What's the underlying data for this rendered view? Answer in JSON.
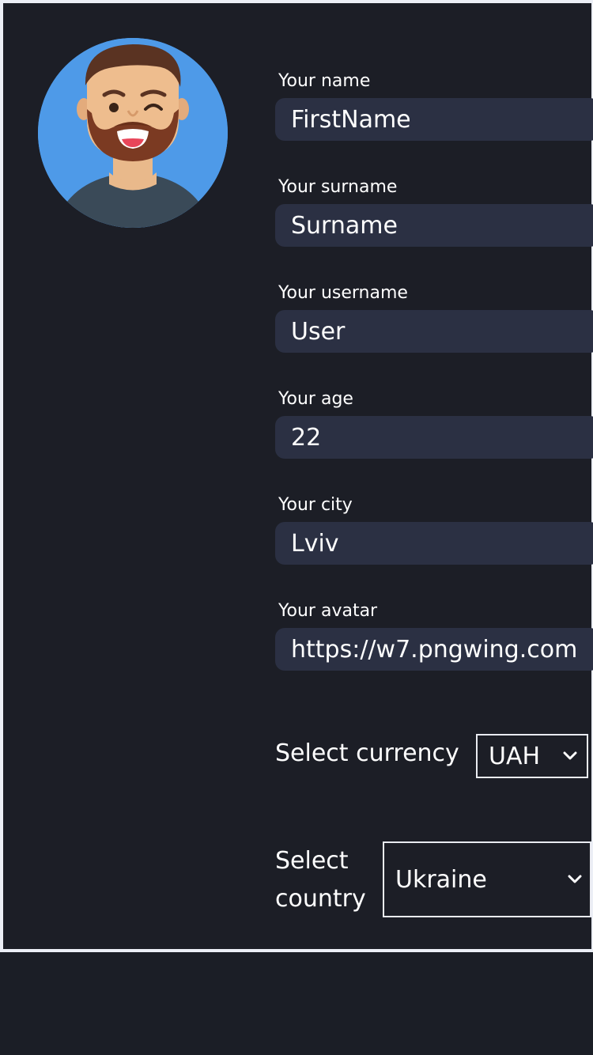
{
  "profile": {
    "avatar_icon": "avatar-image",
    "fields": [
      {
        "label": "Your name",
        "value": "FirstName"
      },
      {
        "label": "Your surname",
        "value": "Surname"
      },
      {
        "label": "Your username",
        "value": "User"
      },
      {
        "label": "Your age",
        "value": "22"
      },
      {
        "label": "Your city",
        "value": "Lviv"
      },
      {
        "label": "Your avatar",
        "value": "https://w7.pngwing.com"
      }
    ]
  },
  "currency": {
    "label": "Select currency",
    "selected": "UAH"
  },
  "country": {
    "label_line1": "Select",
    "label_line2": "country",
    "selected": "Ukraine"
  },
  "colors": {
    "background": "#1c1e26",
    "input_background": "#2b3043",
    "avatar_background": "#4e9ae8",
    "text": "#ffffff"
  }
}
